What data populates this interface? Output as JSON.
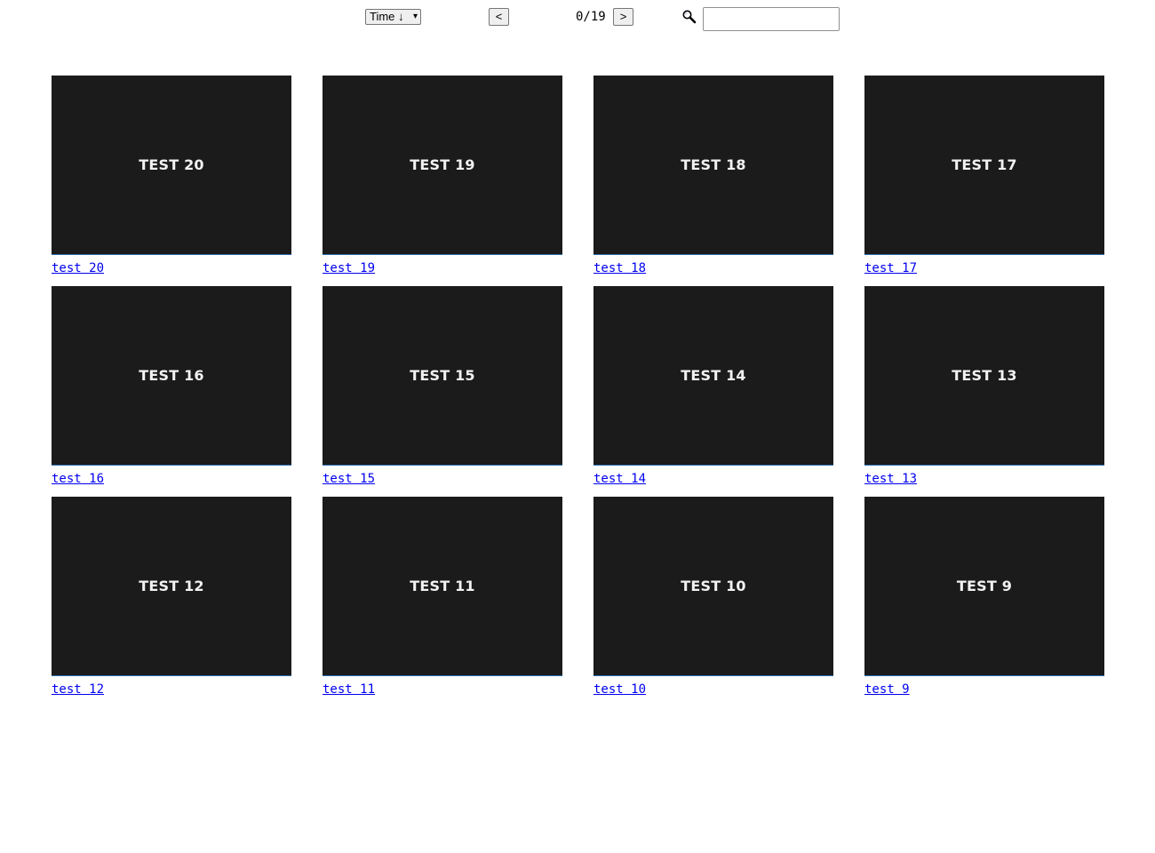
{
  "toolbar": {
    "sort_label": "Time ↓",
    "sort_arrow": "▾",
    "prev_label": "<",
    "next_label": ">",
    "page_counter": "0/19",
    "search_placeholder": "",
    "search_value": "",
    "search_icon": "magnifier-icon"
  },
  "colors": {
    "thumbnail_bg": "#1b1b1b",
    "thumbnail_text": "#f2f2f2",
    "link": "#0000ee",
    "thumbnail_underline": "#2b6fb3"
  },
  "items": [
    {
      "thumb_text": "TEST 20",
      "link_text": "test 20"
    },
    {
      "thumb_text": "TEST 19",
      "link_text": "test 19"
    },
    {
      "thumb_text": "TEST 18",
      "link_text": "test 18"
    },
    {
      "thumb_text": "TEST 17",
      "link_text": "test 17"
    },
    {
      "thumb_text": "TEST 16",
      "link_text": "test 16"
    },
    {
      "thumb_text": "TEST 15",
      "link_text": "test 15"
    },
    {
      "thumb_text": "TEST 14",
      "link_text": "test 14"
    },
    {
      "thumb_text": "TEST 13",
      "link_text": "test 13"
    },
    {
      "thumb_text": "TEST 12",
      "link_text": "test 12"
    },
    {
      "thumb_text": "TEST 11",
      "link_text": "test 11"
    },
    {
      "thumb_text": "TEST 10",
      "link_text": "test 10"
    },
    {
      "thumb_text": "TEST 9",
      "link_text": "test 9"
    }
  ]
}
